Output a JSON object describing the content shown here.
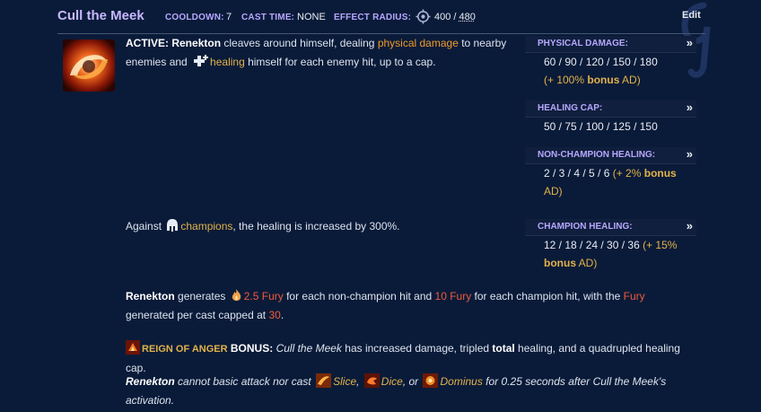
{
  "header": {
    "title": "Cull the Meek",
    "cooldown_label": "COOLDOWN:",
    "cooldown_value": "7",
    "cast_time_label": "CAST TIME:",
    "cast_time_value": "NONE",
    "effect_radius_label": "EFFECT RADIUS:",
    "effect_radius_value_a": "400 / ",
    "effect_radius_value_b": "480",
    "edit_label": "Edit"
  },
  "active": {
    "prefix": "ACTIVE:",
    "champion": "Renekton",
    "t1": " cleaves around himself, dealing ",
    "physical_damage": "physical damage",
    "t2": " to nearby",
    "t3": "enemies and ",
    "healing": "healing",
    "t4": " himself for each enemy hit, up to a cap."
  },
  "against": {
    "t1": "Against ",
    "champions": "champions",
    "t2": ", the healing is increased by 300%."
  },
  "fury": {
    "champion": "Renekton",
    "t1": " generates ",
    "fury_amount_a": "2.5 Fury",
    "t2": " for each non-champion hit and ",
    "fury_amount_b": "10 Fury",
    "t3": " for each champion hit, with the ",
    "fury_word": "Fury",
    "t4": "generated per cast capped at ",
    "cap": "30",
    "t5": "."
  },
  "reign": {
    "name": "REIGN OF ANGER",
    "bonus_label": " BONUS:",
    "ability": "Cull the Meek",
    "t1": " has increased damage, tripled ",
    "total": "total",
    "t2": " healing, and a quadrupled healing cap."
  },
  "restriction": {
    "champion": "Renekton",
    "t1": " cannot basic attack nor cast ",
    "slice": "Slice",
    "comma1": ", ",
    "dice": "Dice",
    "comma2": ", or ",
    "dominus": "Dominus",
    "t2": " for 0.25 seconds after Cull the Meek's",
    "t3": "activation."
  },
  "sidebar": {
    "physical_damage": {
      "label": "PHYSICAL DAMAGE:",
      "values": "60 / 90 / 120 / 150 / 180",
      "bonus_a": "(+ 100% ",
      "bonus_b": "bonus",
      "bonus_c": " AD)"
    },
    "healing_cap": {
      "label": "HEALING CAP:",
      "values": "50 / 75 / 100 / 125 / 150"
    },
    "non_champion_healing": {
      "label": "NON-CHAMPION HEALING:",
      "values": "2 / 3 / 4 / 5 / 6 ",
      "bonus_a": "(+ 2% ",
      "bonus_b": "bonus",
      "bonus_c": "AD)"
    },
    "champion_healing": {
      "label": "CHAMPION HEALING:",
      "values": "12 / 18 / 24 / 30 / 36 ",
      "bonus_a": "(+ 15%",
      "bonus_b": "bonus",
      "bonus_c": " AD)"
    },
    "expand_glyph": "»"
  },
  "icons": [
    "cull-the-meek-icon",
    "effect-radius-icon",
    "heal-icon",
    "champion-helmet-icon",
    "fury-flame-icon",
    "reign-of-anger-icon",
    "slice-icon",
    "dice-icon",
    "dominus-icon"
  ],
  "colors": {
    "background": "#0a1b39",
    "stat_label": "#b7a8ff",
    "title": "#c7b8ff",
    "physical": "#ef9b2a",
    "scaling": "#e2b24a",
    "fury": "#ee5a3a"
  }
}
